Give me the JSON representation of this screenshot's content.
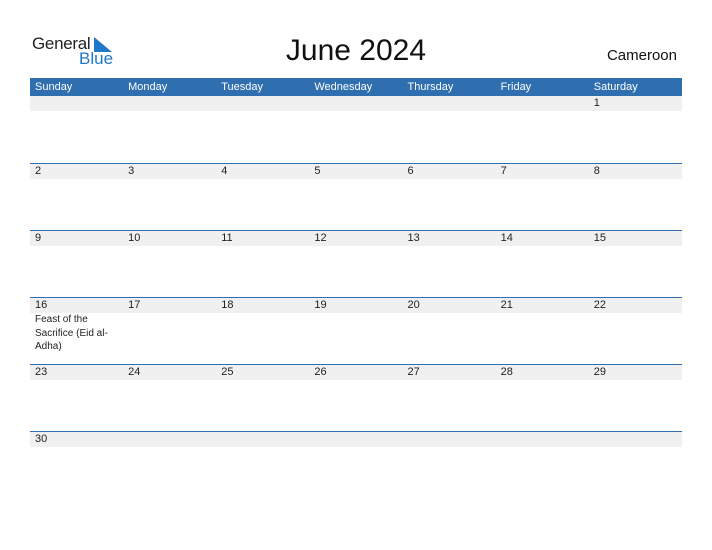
{
  "logo": {
    "word1": "General",
    "word2": "Blue"
  },
  "title": "June 2024",
  "country": "Cameroon",
  "weekdays": [
    "Sunday",
    "Monday",
    "Tuesday",
    "Wednesday",
    "Thursday",
    "Friday",
    "Saturday"
  ],
  "weeks": [
    [
      {
        "d": ""
      },
      {
        "d": ""
      },
      {
        "d": ""
      },
      {
        "d": ""
      },
      {
        "d": ""
      },
      {
        "d": ""
      },
      {
        "d": "1"
      }
    ],
    [
      {
        "d": "2"
      },
      {
        "d": "3"
      },
      {
        "d": "4"
      },
      {
        "d": "5"
      },
      {
        "d": "6"
      },
      {
        "d": "7"
      },
      {
        "d": "8"
      }
    ],
    [
      {
        "d": "9"
      },
      {
        "d": "10"
      },
      {
        "d": "11"
      },
      {
        "d": "12"
      },
      {
        "d": "13"
      },
      {
        "d": "14"
      },
      {
        "d": "15"
      }
    ],
    [
      {
        "d": "16",
        "e": "Feast of the Sacrifice (Eid al-Adha)"
      },
      {
        "d": "17"
      },
      {
        "d": "18"
      },
      {
        "d": "19"
      },
      {
        "d": "20"
      },
      {
        "d": "21"
      },
      {
        "d": "22"
      }
    ],
    [
      {
        "d": "23"
      },
      {
        "d": "24"
      },
      {
        "d": "25"
      },
      {
        "d": "26"
      },
      {
        "d": "27"
      },
      {
        "d": "28"
      },
      {
        "d": "29"
      }
    ],
    [
      {
        "d": "30"
      },
      {
        "d": ""
      },
      {
        "d": ""
      },
      {
        "d": ""
      },
      {
        "d": ""
      },
      {
        "d": ""
      },
      {
        "d": ""
      }
    ]
  ],
  "colors": {
    "header": "#2f6fb0",
    "band": "#f0f0f0",
    "brand": "#1f78c8"
  }
}
